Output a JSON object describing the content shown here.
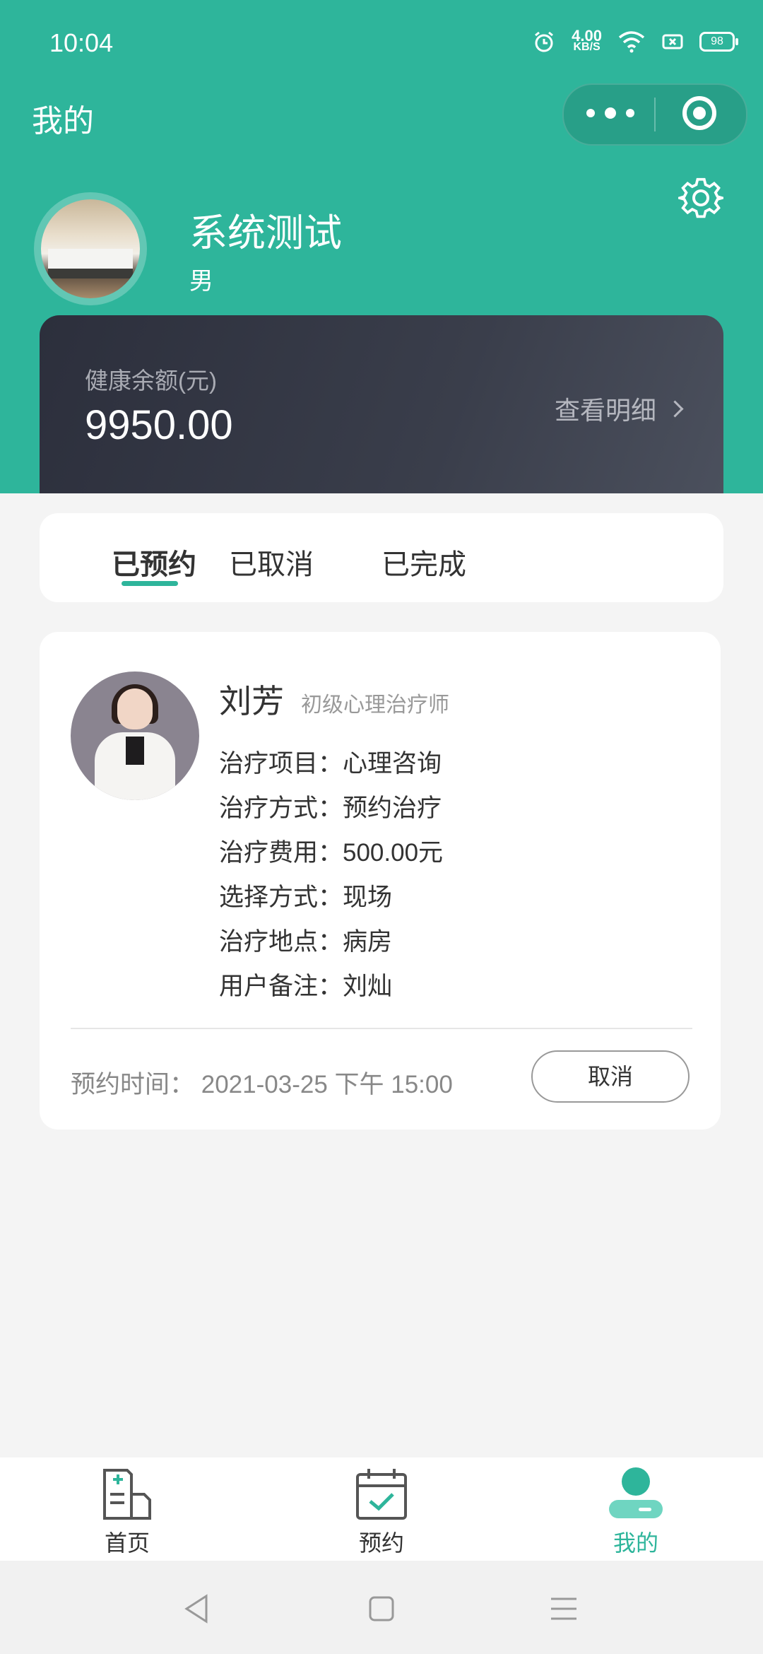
{
  "status_bar": {
    "time": "10:04",
    "net_speed": "4.00",
    "net_unit": "KB/S",
    "battery": "98"
  },
  "header": {
    "title": "我的"
  },
  "profile": {
    "name": "系统测试",
    "gender": "男"
  },
  "balance": {
    "label": "健康余额(元)",
    "value": "9950.00",
    "detail_link": "查看明细"
  },
  "tabs": [
    {
      "label": "已预约",
      "active": true
    },
    {
      "label": "已取消",
      "active": false
    },
    {
      "label": "已完成",
      "active": false
    }
  ],
  "appointment": {
    "doctor_name": "刘芳",
    "doctor_title": "初级心理治疗师",
    "lines": [
      "治疗项目：心理咨询",
      "治疗方式：预约治疗",
      "治疗费用：500.00元",
      "选择方式：现场",
      "治疗地点：病房",
      "用户备注：刘灿"
    ],
    "time_label": "预约时间：",
    "time_value": "2021-03-25 下午 15:00",
    "cancel_label": "取消"
  },
  "bottom_nav": [
    {
      "label": "首页",
      "icon": "home-doc-icon",
      "active": false
    },
    {
      "label": "预约",
      "icon": "calendar-check-icon",
      "active": false
    },
    {
      "label": "我的",
      "icon": "user-icon",
      "active": true
    }
  ],
  "colors": {
    "brand": "#2eb59b",
    "card_dark": "#3a3e4b"
  }
}
